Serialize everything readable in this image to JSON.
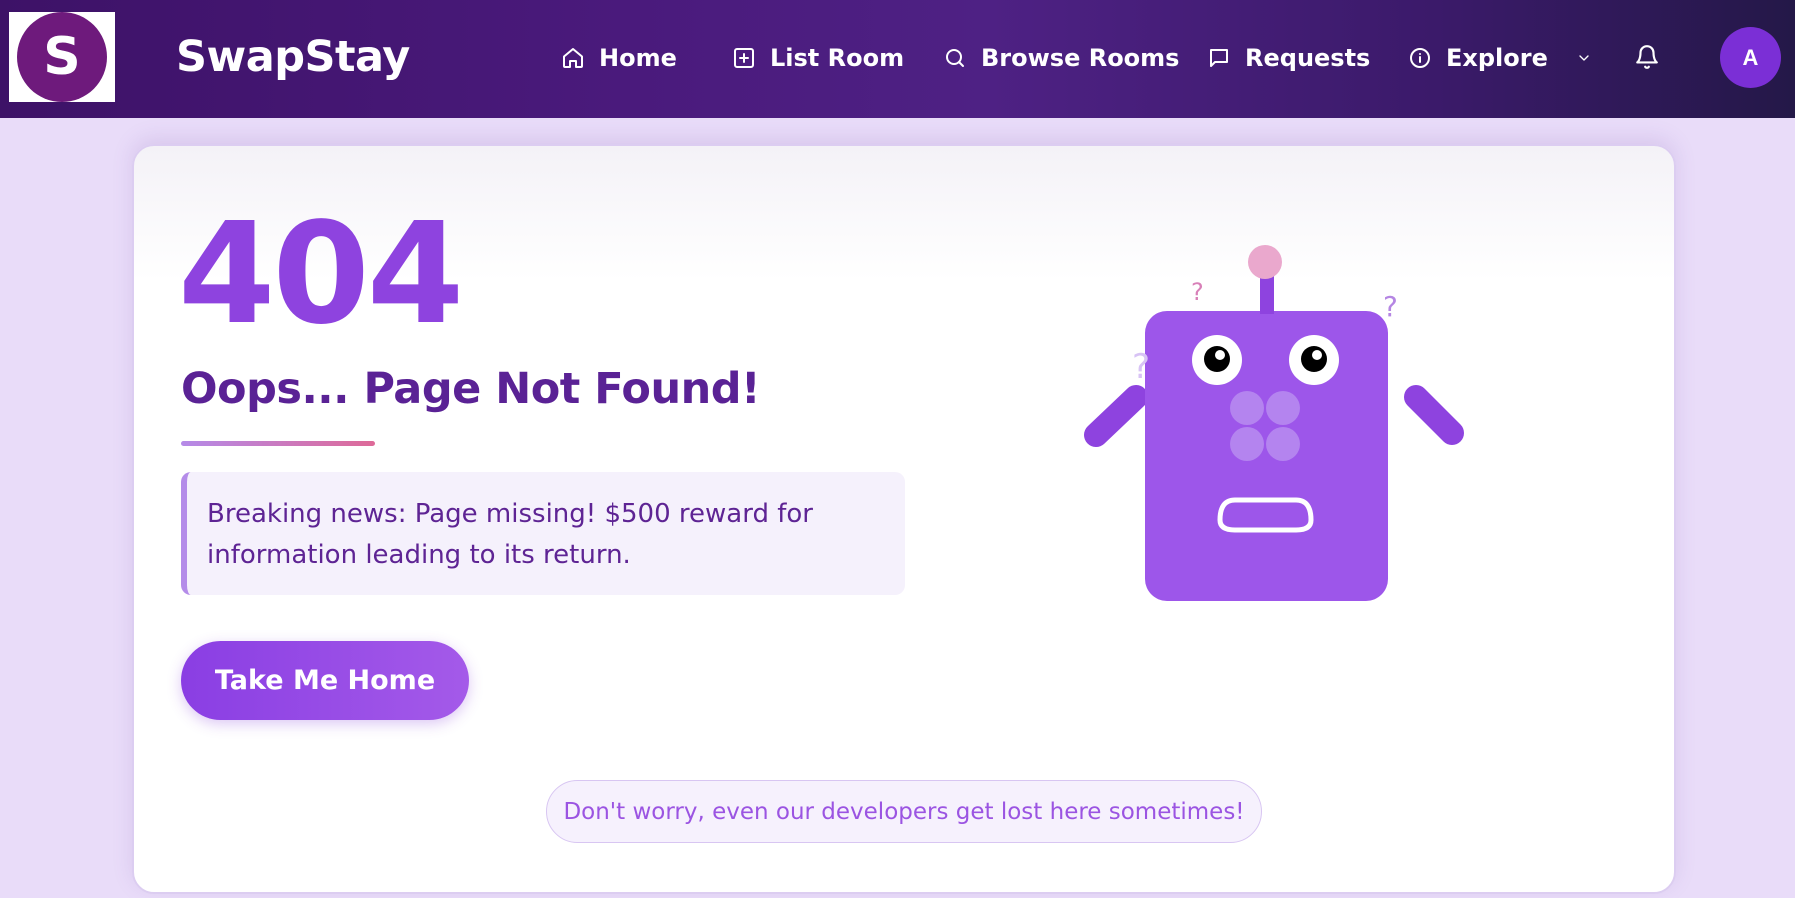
{
  "navbar": {
    "logo_letter": "S",
    "brand": "SwapStay",
    "items": [
      {
        "label": "Home",
        "icon": "home-icon"
      },
      {
        "label": "List Room",
        "icon": "plus-square-icon"
      },
      {
        "label": "Browse Rooms",
        "icon": "search-icon"
      },
      {
        "label": "Requests",
        "icon": "message-icon"
      },
      {
        "label": "Explore",
        "icon": "info-icon"
      }
    ],
    "notifications_icon": "bell-icon",
    "avatar_initial": "A"
  },
  "error": {
    "code": "404",
    "title": "Oops... Page Not Found!",
    "message": "Breaking news: Page missing! $500 reward for information leading to its return.",
    "button_label": "Take Me Home",
    "footer_note": "Don't worry, even our developers get lost here sometimes!"
  },
  "robot": {
    "question_marks": [
      "?",
      "?",
      "?"
    ],
    "body_color": "#9d56ea",
    "antenna_tip_color": "#eaa8cd"
  },
  "colors": {
    "nav_bg": "#4a1a7c",
    "accent": "#8e43df",
    "heading": "#5a2295",
    "page_bg": "#e9dcf9"
  }
}
